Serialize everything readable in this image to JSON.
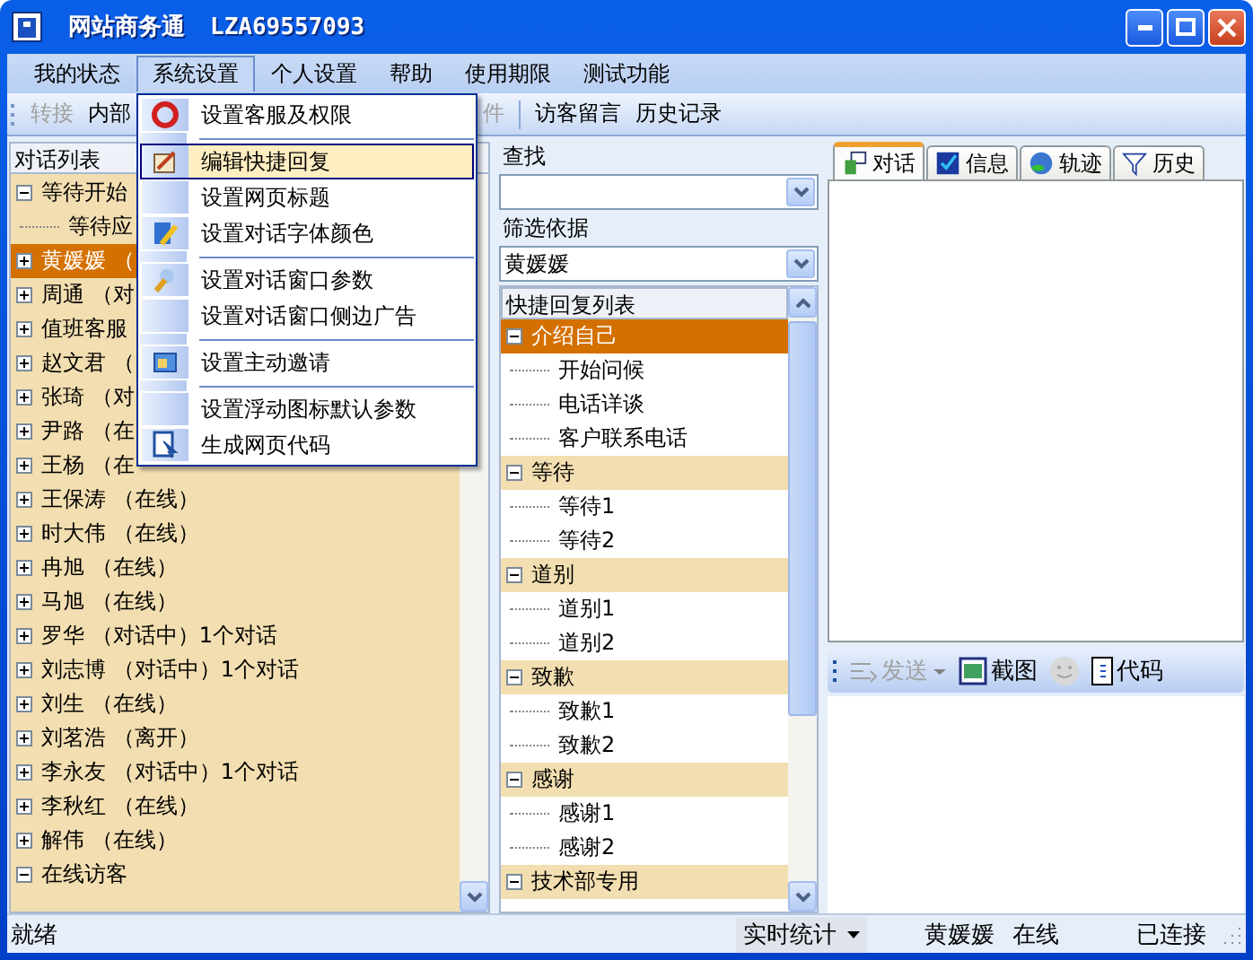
{
  "window": {
    "title": "网站商务通",
    "account": "LZA69557093"
  },
  "menu_bar": [
    {
      "label": "我的状态",
      "selected": false
    },
    {
      "label": "系统设置",
      "selected": true
    },
    {
      "label": "个人设置",
      "selected": false
    },
    {
      "label": "帮助",
      "selected": false
    },
    {
      "label": "使用期限",
      "selected": false
    },
    {
      "label": "测试功能",
      "selected": false
    }
  ],
  "open_menu": [
    {
      "kind": "item",
      "label": "设置客服及权限",
      "icon": true,
      "selected": false
    },
    {
      "kind": "separator"
    },
    {
      "kind": "item",
      "label": "编辑快捷回复",
      "icon": true,
      "selected": true
    },
    {
      "kind": "item",
      "label": "设置网页标题",
      "icon": false,
      "selected": false
    },
    {
      "kind": "item",
      "label": "设置对话字体颜色",
      "icon": true,
      "selected": false
    },
    {
      "kind": "separator"
    },
    {
      "kind": "item",
      "label": "设置对话窗口参数",
      "icon": true,
      "selected": false
    },
    {
      "kind": "item",
      "label": "设置对话窗口侧边广告",
      "icon": false,
      "selected": false
    },
    {
      "kind": "separator"
    },
    {
      "kind": "item",
      "label": "设置主动邀请",
      "icon": true,
      "selected": false
    },
    {
      "kind": "separator"
    },
    {
      "kind": "item",
      "label": "设置浮动图标默认参数",
      "icon": false,
      "selected": false
    },
    {
      "kind": "item",
      "label": "生成网页代码",
      "icon": true,
      "selected": false
    }
  ],
  "toolbar": [
    {
      "label": "转接",
      "disabled": true
    },
    {
      "label": "内部",
      "disabled": false
    },
    {
      "label": "件",
      "disabled": true
    },
    {
      "label": "访客留言",
      "disabled": false
    },
    {
      "label": "历史记录",
      "disabled": false
    }
  ],
  "conversations": {
    "header": "对话列表",
    "items": [
      {
        "label": "等待开始",
        "expanded": true,
        "selected": false,
        "children": [
          {
            "label": "等待应",
            "selected": false
          }
        ]
      },
      {
        "label": "黄媛媛 （",
        "expanded": false,
        "selected": true
      },
      {
        "label": "周通 （对",
        "expanded": false,
        "selected": false
      },
      {
        "label": "值班客服",
        "expanded": false,
        "selected": false
      },
      {
        "label": "赵文君 （",
        "expanded": false,
        "selected": false
      },
      {
        "label": "张琦 （对",
        "expanded": false,
        "selected": false
      },
      {
        "label": "尹路 （在",
        "expanded": false,
        "selected": false
      },
      {
        "label": "王杨 （在",
        "expanded": false,
        "selected": false
      },
      {
        "label": "王保涛 （在线）",
        "expanded": false,
        "selected": false
      },
      {
        "label": "时大伟 （在线）",
        "expanded": false,
        "selected": false
      },
      {
        "label": "冉旭 （在线）",
        "expanded": false,
        "selected": false
      },
      {
        "label": "马旭 （在线）",
        "expanded": false,
        "selected": false
      },
      {
        "label": "罗华 （对话中）1个对话",
        "expanded": false,
        "selected": false
      },
      {
        "label": "刘志博 （对话中）1个对话",
        "expanded": false,
        "selected": false
      },
      {
        "label": "刘生 （在线）",
        "expanded": false,
        "selected": false
      },
      {
        "label": "刘茗浩 （离开）",
        "expanded": false,
        "selected": false
      },
      {
        "label": "李永友 （对话中）1个对话",
        "expanded": false,
        "selected": false
      },
      {
        "label": "李秋红 （在线）",
        "expanded": false,
        "selected": false
      },
      {
        "label": "解伟 （在线）",
        "expanded": false,
        "selected": false
      },
      {
        "label": "在线访客",
        "expanded": true,
        "selected": false
      }
    ]
  },
  "search": {
    "label": "查找"
  },
  "filter": {
    "label": "筛选依据",
    "value": "黄媛媛"
  },
  "quick_replies": {
    "header": "快捷回复列表",
    "groups": [
      {
        "label": "介绍自己",
        "expanded": true,
        "selected": true,
        "children": [
          {
            "label": "开始问候"
          },
          {
            "label": "电话详谈"
          },
          {
            "label": "客户联系电话"
          }
        ]
      },
      {
        "label": "等待",
        "expanded": true,
        "selected": false,
        "children": [
          {
            "label": "等待1"
          },
          {
            "label": "等待2"
          }
        ]
      },
      {
        "label": "道别",
        "expanded": true,
        "selected": false,
        "children": [
          {
            "label": "道别1"
          },
          {
            "label": "道别2"
          }
        ]
      },
      {
        "label": "致歉",
        "expanded": true,
        "selected": false,
        "children": [
          {
            "label": "致歉1"
          },
          {
            "label": "致歉2"
          }
        ]
      },
      {
        "label": "感谢",
        "expanded": true,
        "selected": false,
        "children": [
          {
            "label": "感谢1"
          },
          {
            "label": "感谢2"
          }
        ]
      },
      {
        "label": "技术部专用",
        "expanded": true,
        "selected": false
      }
    ]
  },
  "tabs": [
    {
      "label": "对话",
      "selected": true
    },
    {
      "label": "信息",
      "selected": false
    },
    {
      "label": "轨迹",
      "selected": false
    },
    {
      "label": "历史",
      "selected": false
    }
  ],
  "chat_toolbar": {
    "send": {
      "label": "发送",
      "disabled": true
    },
    "screenshot": "截图",
    "emoji_disabled": true,
    "code": "代码"
  },
  "status_bar": {
    "message": "就绪",
    "stats": "实时统计",
    "user": "黄媛媛",
    "presence": "在线",
    "connection": "已连接"
  }
}
